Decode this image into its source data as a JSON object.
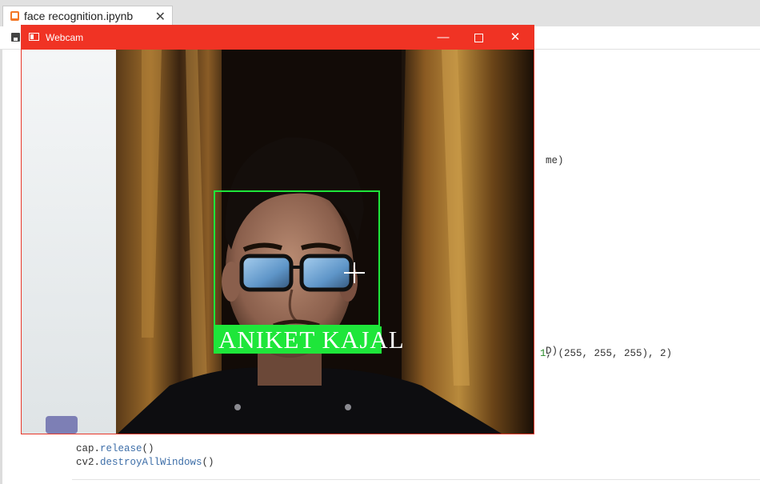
{
  "browser_tab": {
    "title": "face recognition.ipynb",
    "close_glyph": "✕",
    "icon": "jupyter-notebook-icon"
  },
  "toolbar": {
    "save_icon": "save-icon"
  },
  "code": {
    "partial_line_1": "me)",
    "partial_line_2": "D)",
    "partial_line_3_num1": "1",
    "partial_line_3_rest": ", (255, 255, 255), 2)",
    "line_release_obj": "cap.",
    "line_release_fn": "release",
    "line_release_end": "()",
    "line_destroy_obj": "cv2.",
    "line_destroy_fn": "destroyAllWindows",
    "line_destroy_end": "()"
  },
  "webcam_window": {
    "title": "Webcam",
    "minimize_glyph": "—",
    "close_glyph": "✕",
    "detected_name": "ANIKET KAJAL"
  },
  "colors": {
    "titlebar": "#f03324",
    "detection_box": "#1ee63a"
  }
}
